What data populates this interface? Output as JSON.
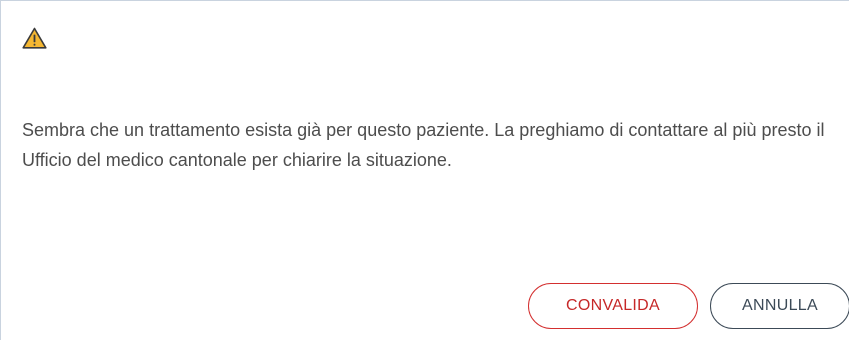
{
  "dialog": {
    "icon": "warning-icon",
    "message": "Sembra che un trattamento esista già per questo paziente. La preghiamo di contattare al più presto il Ufficio del medico cantonale per chiarire la situazione.",
    "buttons": {
      "confirm_label": "CONVALIDA",
      "cancel_label": "ANNULLA"
    }
  },
  "colors": {
    "warning_fill": "#f5b731",
    "confirm_accent": "#d32f2f",
    "cancel_border": "#3c4a57",
    "text": "#4d4d4d"
  }
}
